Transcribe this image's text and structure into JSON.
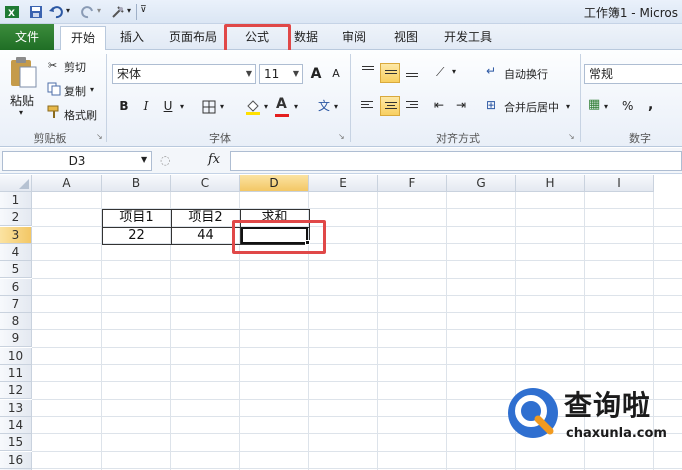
{
  "window": {
    "title": "工作簿1 - Micros"
  },
  "ribbon_tabs": [
    {
      "label": "文件"
    },
    {
      "label": "开始"
    },
    {
      "label": "插入"
    },
    {
      "label": "页面布局"
    },
    {
      "label": "公式"
    },
    {
      "label": "数据"
    },
    {
      "label": "审阅"
    },
    {
      "label": "视图"
    },
    {
      "label": "开发工具"
    }
  ],
  "clipboard": {
    "paste": "粘贴",
    "cut": "剪切",
    "copy": "复制",
    "format_painter": "格式刷",
    "label": "剪贴板"
  },
  "font": {
    "name": "宋体",
    "size": "11",
    "label": "字体",
    "bold": "B",
    "italic": "I",
    "underline": "U",
    "grow": "A",
    "shrink": "A"
  },
  "alignment": {
    "wrap": "自动换行",
    "merge": "合并后居中",
    "label": "对齐方式"
  },
  "number": {
    "format": "常规",
    "percent": "%",
    "comma": ",",
    "label": "数字"
  },
  "formula_bar": {
    "name_box": "D3",
    "fx": "fx",
    "value": ""
  },
  "grid": {
    "columns": [
      "A",
      "B",
      "C",
      "D",
      "E",
      "F",
      "G",
      "H",
      "I"
    ],
    "rows": [
      "1",
      "2",
      "3",
      "4",
      "5",
      "6",
      "7",
      "8",
      "9",
      "10",
      "11",
      "12",
      "13",
      "14",
      "15",
      "16",
      "17"
    ],
    "active_column": "D",
    "active_row": "3",
    "cells": {
      "B2": "项目1",
      "C2": "项目2",
      "D2": "求和",
      "B3": "22",
      "C3": "44",
      "D3": ""
    }
  },
  "watermark": {
    "brand": "查询啦",
    "domain": "chaxunla.com"
  },
  "colors": {
    "highlight": "#e04848",
    "file_tab": "#2a7a2e",
    "active_header": "#f3c765",
    "watermark_blue": "#2f6fd0",
    "watermark_orange": "#f19a1f"
  }
}
